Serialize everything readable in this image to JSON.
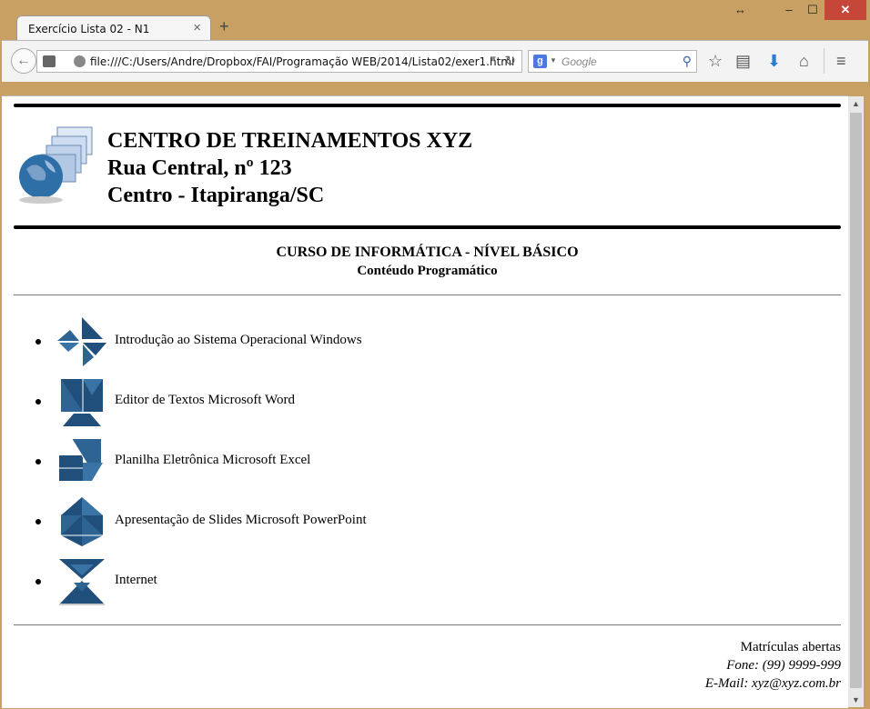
{
  "browser": {
    "tab_title": "Exercício Lista 02 - N1",
    "url": "file:///C:/Users/Andre/Dropbox/FAI/Programação WEB/2014/Lista02/exer1.html",
    "search_placeholder": "Google",
    "search_engine_letter": "g"
  },
  "header": {
    "line1": "CENTRO DE TREINAMENTOS XYZ",
    "line2": "Rua Central, nº 123",
    "line3": "Centro - Itapiranga/SC"
  },
  "course": {
    "title": "CURSO DE INFORMÁTICA - NÍVEL BÁSICO",
    "subtitle": "Contéudo Programático"
  },
  "items": [
    {
      "label": "Introdução ao Sistema Operacional Windows",
      "icon": "tangram-windows-icon"
    },
    {
      "label": "Editor de Textos Microsoft Word",
      "icon": "tangram-word-icon"
    },
    {
      "label": "Planilha Eletrônica Microsoft Excel",
      "icon": "tangram-excel-icon"
    },
    {
      "label": "Apresentação de Slides Microsoft PowerPoint",
      "icon": "tangram-powerpoint-icon"
    },
    {
      "label": "Internet",
      "icon": "tangram-internet-icon"
    }
  ],
  "footer": {
    "line1": "Matrículas abertas",
    "line2": "Fone: (99) 9999-999",
    "line3": "E-Mail: xyz@xyz.com.br"
  },
  "colors": {
    "frame": "#c9a063",
    "close_button": "#c7463a",
    "icon_blue": "#1f4f7a",
    "download_arrow": "#2a7ad6"
  }
}
